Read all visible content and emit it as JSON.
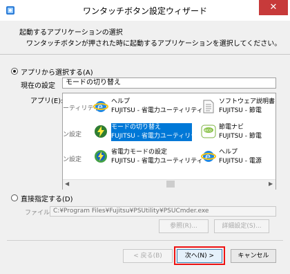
{
  "window": {
    "title": "ワンタッチボタン設定ウィザード",
    "close_glyph": "✕"
  },
  "header": {
    "title": "起動するアプリケーションの選択",
    "description": "ワンタッチボタンが押された時に起動するアプリケーションを選択してください。"
  },
  "select_from_app": {
    "radio_label": "アプリから選択する(A)",
    "selected": true,
    "current_label": "現在の設定",
    "current_value": "モードの切り替え",
    "app_label": "アプリ(E):",
    "apps": [
      {
        "name": "ーティリティ",
        "sub": "",
        "icon": "partial",
        "selected": false
      },
      {
        "name": "ヘルプ",
        "sub": "FUJITSU - 省電力ユーティリティ",
        "icon": "ie-icon",
        "selected": false
      },
      {
        "name": "ソフトウェア説明書",
        "sub": "FUJITSU - 節電",
        "icon": "document-icon",
        "selected": false
      },
      {
        "name": "ン設定",
        "sub": "",
        "icon": "partial",
        "selected": false
      },
      {
        "name": "モードの切り替え",
        "sub": "FUJITSU - 省電力ユーティリティ",
        "icon": "power-mode-icon",
        "selected": true
      },
      {
        "name": "節電ナビ",
        "sub": "FUJITSU - 節電",
        "icon": "eco-icon",
        "selected": false
      },
      {
        "name": "ン設定",
        "sub": "",
        "icon": "partial",
        "selected": false
      },
      {
        "name": "省電力モードの設定",
        "sub": "FUJITSU - 省電力ユーティリティ",
        "icon": "power-setting-icon",
        "selected": false
      },
      {
        "name": "ヘルプ",
        "sub": "FUJITSU - 電源",
        "icon": "ie-icon",
        "selected": false
      }
    ]
  },
  "direct_specify": {
    "radio_label": "直接指定する(D)",
    "selected": false,
    "file_label": "ファイル",
    "file_value": "C:¥Program Files¥Fujitsu¥PSUtility¥PSUCmder.exe",
    "browse_label": "参照(R)...",
    "advanced_label": "詳細設定(S)..."
  },
  "footer": {
    "back_label": "< 戻る(B)",
    "next_label": "次へ(N) >",
    "cancel_label": "キャンセル"
  },
  "colors": {
    "selection": "#0078d7",
    "highlight_box": "#e11111"
  }
}
